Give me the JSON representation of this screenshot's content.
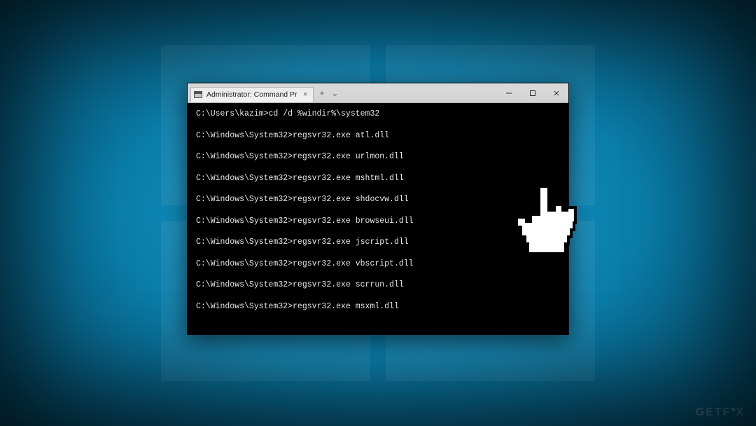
{
  "window": {
    "tab": {
      "title": "Administrator: Command Prom",
      "close_glyph": "×"
    },
    "tabbar": {
      "new_tab_glyph": "+",
      "dropdown_glyph": "⌄"
    },
    "controls": {
      "minimize_glyph": "—",
      "maximize_glyph": "▢",
      "close_glyph": "×"
    }
  },
  "terminal": {
    "lines": [
      "C:\\Users\\kazim>cd /d %windir%\\system32",
      "C:\\Windows\\System32>regsvr32.exe atl.dll",
      "C:\\Windows\\System32>regsvr32.exe urlmon.dll",
      "C:\\Windows\\System32>regsvr32.exe mshtml.dll",
      "C:\\Windows\\System32>regsvr32.exe shdocvw.dll",
      "C:\\Windows\\System32>regsvr32.exe browseui.dll",
      "C:\\Windows\\System32>regsvr32.exe jscript.dll",
      "C:\\Windows\\System32>regsvr32.exe vbscript.dll",
      "C:\\Windows\\System32>regsvr32.exe scrrun.dll",
      "C:\\Windows\\System32>regsvr32.exe msxml.dll"
    ]
  },
  "watermark": "G E T F  X"
}
